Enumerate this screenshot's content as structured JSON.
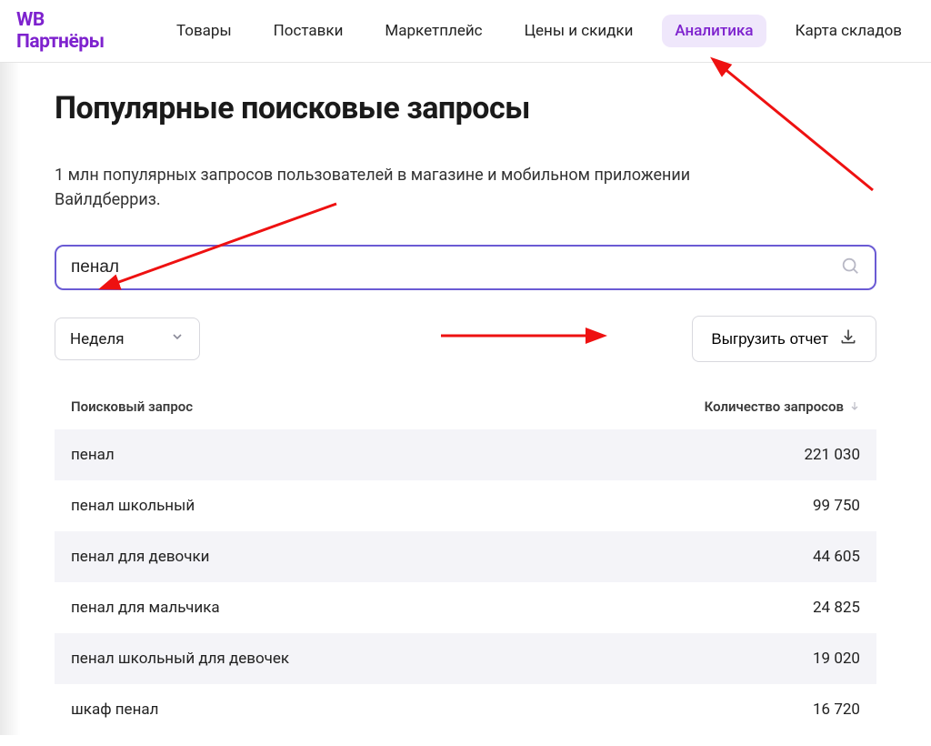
{
  "logo": "WB Партнёры",
  "nav": {
    "items": [
      {
        "label": "Товары",
        "active": false
      },
      {
        "label": "Поставки",
        "active": false
      },
      {
        "label": "Маркетплейс",
        "active": false
      },
      {
        "label": "Цены и скидки",
        "active": false
      },
      {
        "label": "Аналитика",
        "active": true
      },
      {
        "label": "Карта складов",
        "active": false
      }
    ]
  },
  "title": "Популярные поисковые запросы",
  "lead": "1 млн популярных запросов пользователей в магазине и мобильном приложении Вайлдберриз.",
  "search": {
    "value": "пенал"
  },
  "period_select": {
    "selected": "Неделя"
  },
  "export_button": "Выгрузить отчет",
  "table": {
    "columns": {
      "query": "Поисковый запрос",
      "count": "Количество запросов"
    },
    "rows": [
      {
        "query": "пенал",
        "count": "221 030"
      },
      {
        "query": "пенал школьный",
        "count": "99 750"
      },
      {
        "query": "пенал для девочки",
        "count": "44 605"
      },
      {
        "query": "пенал для мальчика",
        "count": "24 825"
      },
      {
        "query": "пенал школьный для девочек",
        "count": "19 020"
      },
      {
        "query": "шкаф пенал",
        "count": "16 720"
      }
    ]
  }
}
